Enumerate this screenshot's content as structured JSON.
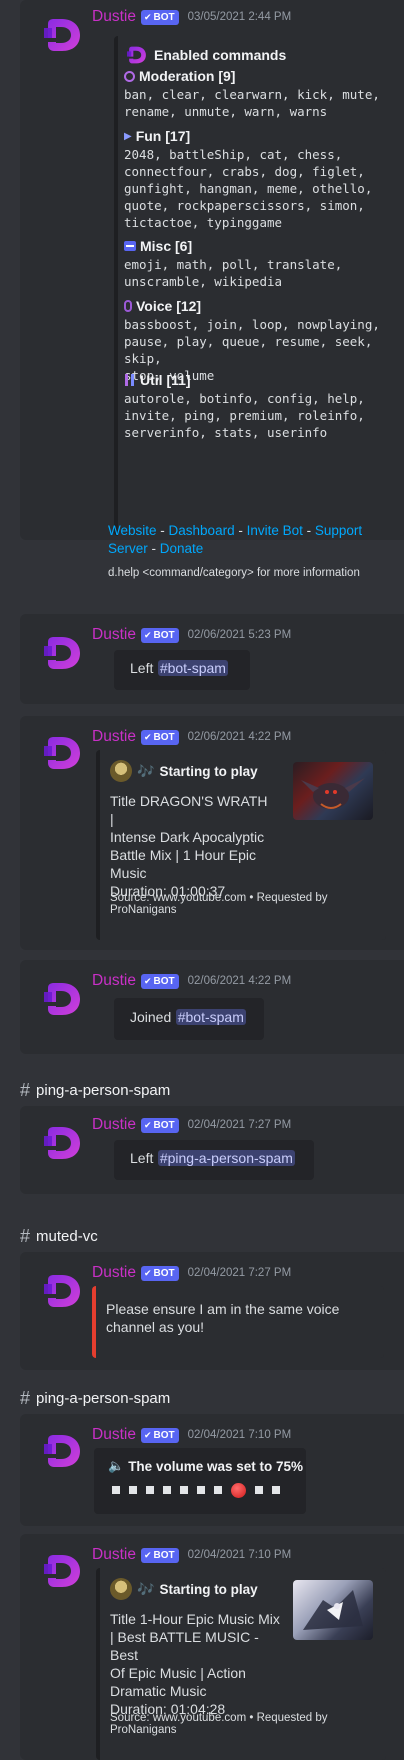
{
  "bot": {
    "name": "Dustie",
    "tag": "BOT"
  },
  "messages": [
    {
      "timestamp": "03/05/2021 2:44 PM",
      "embed": {
        "title": "Enabled commands",
        "sections": [
          {
            "title": "Moderation [9]",
            "lines": [
              "ban, clear, clearwarn, kick, mute,",
              "rename, unmute, warn, warns"
            ]
          },
          {
            "title": "Fun [17]",
            "lines": [
              "2048, battleShip, cat, chess,",
              "connectfour, crabs, dog, figlet,",
              "gunfight, hangman, meme, othello,",
              "quote, rockpaperscissors, simon,",
              "tictactoe, typinggame"
            ]
          },
          {
            "title": "Misc [6]",
            "lines": [
              "emoji, math, poll, translate,",
              "unscramble, wikipedia"
            ]
          },
          {
            "title": "Voice [12]",
            "lines": [
              "bassboost, join, loop, nowplaying,",
              "pause, play, queue, resume, seek, skip,",
              "stop, volume"
            ]
          },
          {
            "title": "Util [11]",
            "lines": [
              "autorole, botinfo, config, help,",
              "invite, ping, premium, roleinfo,",
              "serverinfo, stats, userinfo"
            ]
          }
        ],
        "links": {
          "website": "Website",
          "dashboard": "Dashboard",
          "invite": "Invite Bot",
          "support1": "Support",
          "support2": "Server",
          "donate": "Donate",
          "sep": " - "
        },
        "footer": "d.help <command/category> for more information"
      }
    },
    {
      "timestamp": "02/06/2021 5:23 PM",
      "text": "Left",
      "mention": "#bot-spam"
    },
    {
      "timestamp": "02/06/2021 4:22 PM",
      "embed": {
        "author": "Starting to play",
        "lines": [
          "Title DRAGON'S WRATH |",
          "Intense Dark Apocalyptic",
          "Battle Mix | 1 Hour Epic",
          "Music",
          "Duration: 01:00:37"
        ],
        "footer1": "Source: www.youtube.com • Requested by",
        "footer2": "ProNanigans"
      }
    },
    {
      "timestamp": "02/06/2021 4:22 PM",
      "text": "Joined",
      "mention": "#bot-spam"
    },
    {
      "channel": "ping-a-person-spam"
    },
    {
      "timestamp": "02/04/2021 7:27 PM",
      "text": "Left",
      "mention": "#ping-a-person-spam"
    },
    {
      "channel": "muted-vc"
    },
    {
      "timestamp": "02/04/2021 7:27 PM",
      "lines": [
        "Please ensure I am in the same voice",
        "channel as you!"
      ]
    },
    {
      "channel": "ping-a-person-spam"
    },
    {
      "timestamp": "02/04/2021 7:10 PM",
      "title": "The volume was set to 75%",
      "volume_level": 0.75
    },
    {
      "timestamp": "02/04/2021 7:10 PM",
      "embed": {
        "author": "Starting to play",
        "lines": [
          "Title 1-Hour Epic Music Mix",
          "| Best BATTLE MUSIC - Best",
          "Of Epic Music | Action",
          "Dramatic Music",
          "Duration: 01:04:28"
        ],
        "footer1": "Source: www.youtube.com • Requested by",
        "footer2": "ProNanigans"
      }
    }
  ],
  "colors": {
    "username": "#c930c7",
    "bot_badge": "#5865f2",
    "link": "#00a8fc",
    "error_bar": "#e53e2f",
    "mention_bg": "#3c4270"
  },
  "icons": [
    "dustie-avatar",
    "check-icon",
    "dustie-logo-icon",
    "moderation-icon",
    "fun-icon",
    "misc-icon",
    "voice-icon",
    "util-icon",
    "music-notes-icon",
    "speaker-icon",
    "hash-icon"
  ]
}
